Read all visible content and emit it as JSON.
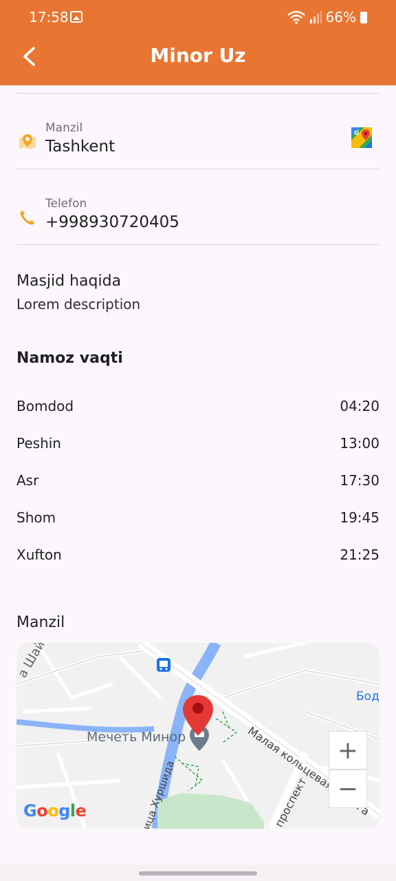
{
  "status_bar": {
    "time": "17:58",
    "battery": "66%"
  },
  "header": {
    "title": "Minor Uz",
    "back_icon": "chevron-left-icon"
  },
  "address": {
    "label": "Manzil",
    "value": "Tashkent",
    "icon": "map-pin-icon"
  },
  "phone": {
    "label": "Telefon",
    "value": "+998930720405",
    "icon": "phone-icon"
  },
  "about": {
    "title": "Masjid haqida",
    "description": "Lorem description"
  },
  "prayer": {
    "title": "Namoz vaqti",
    "times": [
      {
        "name": "Bomdod",
        "time": "04:20"
      },
      {
        "name": "Peshin",
        "time": "13:00"
      },
      {
        "name": "Asr",
        "time": "17:30"
      },
      {
        "name": "Shom",
        "time": "19:45"
      },
      {
        "name": "Xufton",
        "time": "21:25"
      }
    ]
  },
  "location": {
    "title": "Manzil",
    "map": {
      "place_name": "Мечеть Минор",
      "road_1": "Малая кольцевая дорога",
      "road_2": "проспект",
      "road_3": "ица Хуршида",
      "road_4": "а Шайх",
      "label_right": "Бод",
      "zoom_in": "+",
      "zoom_out": "−",
      "google": "Google"
    }
  },
  "colors": {
    "accent": "#e97532",
    "pin": "#e53935",
    "water": "#8ab4f8",
    "park": "#c8e6c9"
  }
}
